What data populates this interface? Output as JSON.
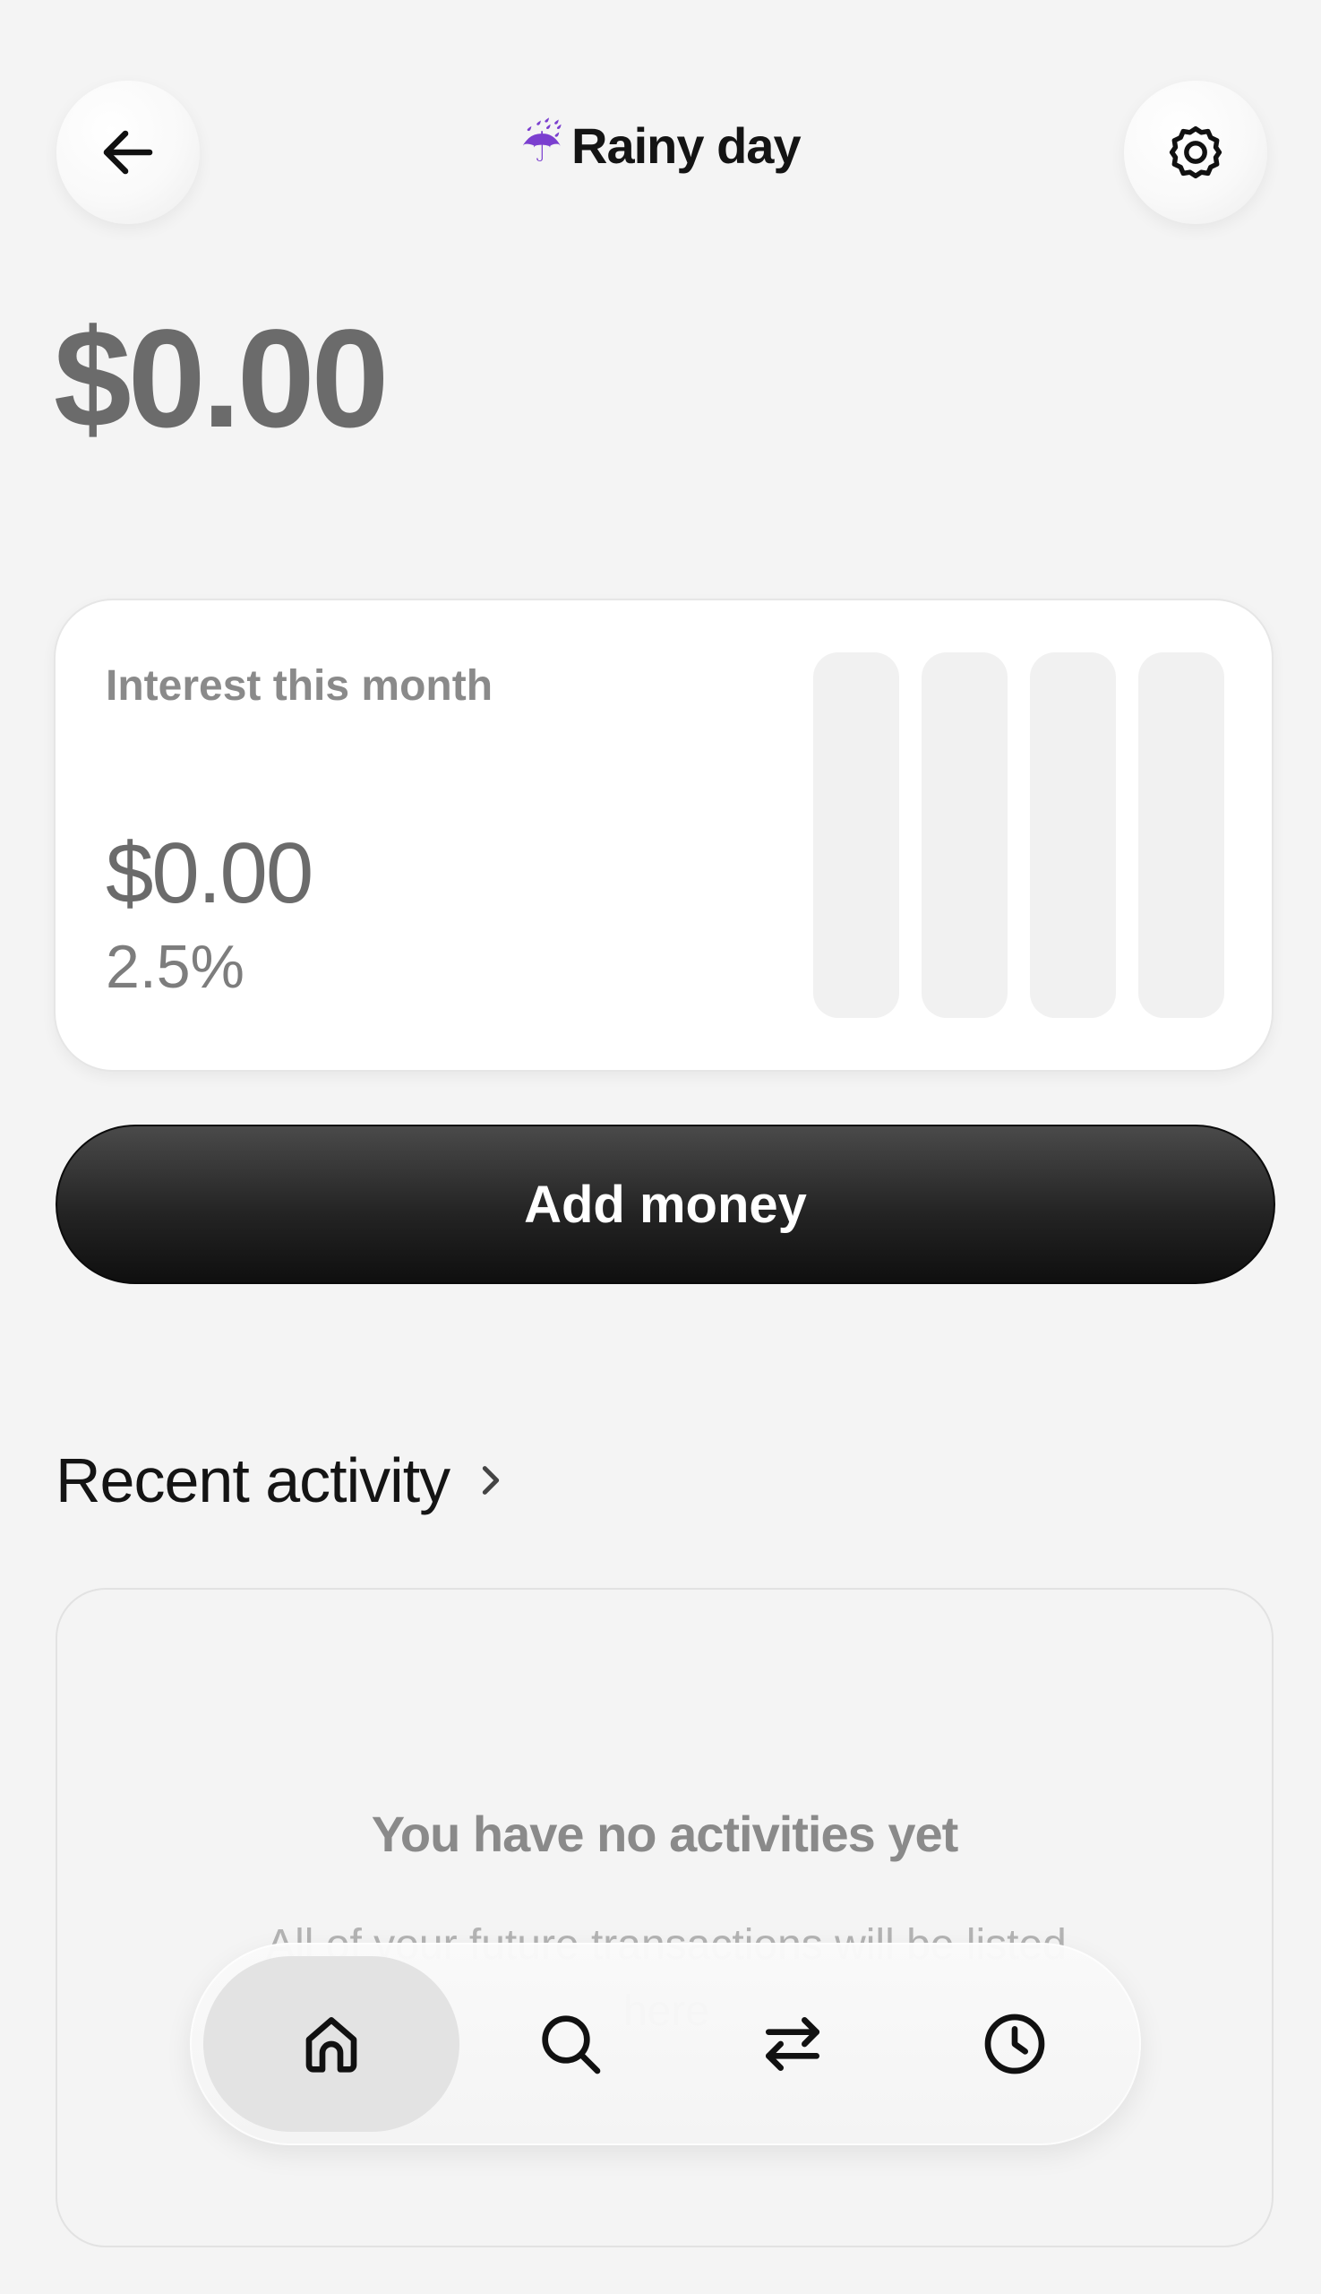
{
  "header": {
    "title_emoji": "☔",
    "title": "Rainy day",
    "back_icon": "arrow-left-icon",
    "settings_icon": "gear-icon"
  },
  "balance": "$0.00",
  "interest_card": {
    "label": "Interest this month",
    "amount": "$0.00",
    "rate": "2.5%",
    "bars_count": 4
  },
  "add_money_label": "Add money",
  "recent_activity": {
    "title": "Recent activity",
    "empty_title": "You have no activities yet",
    "empty_subtitle": "All of your future transactions will be listed here"
  },
  "bottom_nav": {
    "items": [
      {
        "icon": "home-icon",
        "active": true
      },
      {
        "icon": "search-icon",
        "active": false
      },
      {
        "icon": "transfer-icon",
        "active": false
      },
      {
        "icon": "clock-icon",
        "active": false
      }
    ]
  },
  "colors": {
    "background": "#f4f4f4",
    "button_dark": "#121212",
    "muted_text": "#6b6b6b"
  }
}
